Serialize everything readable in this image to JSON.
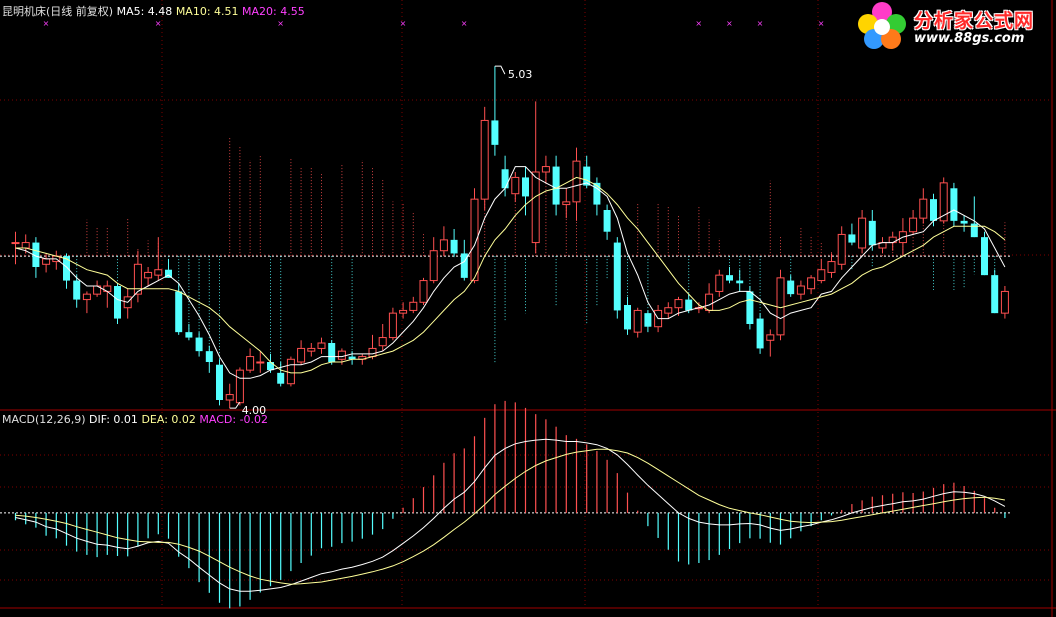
{
  "header": {
    "title": "昆明机床(日线 前复权)",
    "ma5": "MA5: 4.48",
    "ma10": "MA10: 4.51",
    "ma20": "MA20: 4.55",
    "macd_label": "MACD(12,26,9)",
    "dif": "DIF: 0.01",
    "dea": "DEA: 0.02",
    "macd": "MACD: -0.02"
  },
  "logo": {
    "text": "分析家公式网",
    "url": "www.88gs.com",
    "icon": "flower-icon"
  },
  "colors": {
    "up": "#ff5050",
    "down": "#54ffff",
    "ma5": "#ffffff",
    "ma10": "#ffff99",
    "grid": "#800000",
    "macd_text": "#ff40ff"
  },
  "chart_data": [
    {
      "type": "candlestick",
      "title": "昆明机床(日线 前复权)",
      "annotations": [
        {
          "label": "5.03",
          "kind": "high"
        },
        {
          "label": "4.00",
          "kind": "low"
        }
      ],
      "ylim": [
        3.8,
        5.2
      ],
      "candles": [
        {
          "o": 4.38,
          "h": 4.42,
          "l": 4.3,
          "c": 4.38
        },
        {
          "o": 4.36,
          "h": 4.41,
          "l": 4.34,
          "c": 4.38
        },
        {
          "o": 4.38,
          "h": 4.4,
          "l": 4.25,
          "c": 4.29
        },
        {
          "o": 4.3,
          "h": 4.34,
          "l": 4.27,
          "c": 4.32
        },
        {
          "o": 4.31,
          "h": 4.35,
          "l": 4.28,
          "c": 4.33
        },
        {
          "o": 4.33,
          "h": 4.34,
          "l": 4.21,
          "c": 4.24
        },
        {
          "o": 4.24,
          "h": 4.26,
          "l": 4.14,
          "c": 4.17
        },
        {
          "o": 4.17,
          "h": 4.2,
          "l": 4.12,
          "c": 4.19
        },
        {
          "o": 4.19,
          "h": 4.24,
          "l": 4.18,
          "c": 4.22
        },
        {
          "o": 4.2,
          "h": 4.24,
          "l": 4.14,
          "c": 4.22
        },
        {
          "o": 4.22,
          "h": 4.23,
          "l": 4.08,
          "c": 4.1
        },
        {
          "o": 4.14,
          "h": 4.21,
          "l": 4.1,
          "c": 4.18
        },
        {
          "o": 4.19,
          "h": 4.35,
          "l": 4.16,
          "c": 4.3
        },
        {
          "o": 4.25,
          "h": 4.29,
          "l": 4.22,
          "c": 4.27
        },
        {
          "o": 4.26,
          "h": 4.4,
          "l": 4.24,
          "c": 4.28
        },
        {
          "o": 4.28,
          "h": 4.32,
          "l": 4.25,
          "c": 4.25
        },
        {
          "o": 4.2,
          "h": 4.23,
          "l": 4.04,
          "c": 4.05
        },
        {
          "o": 4.05,
          "h": 4.08,
          "l": 4.02,
          "c": 4.03
        },
        {
          "o": 4.03,
          "h": 4.05,
          "l": 3.96,
          "c": 3.98
        },
        {
          "o": 3.98,
          "h": 4.0,
          "l": 3.9,
          "c": 3.94
        },
        {
          "o": 3.93,
          "h": 3.95,
          "l": 3.78,
          "c": 3.8
        },
        {
          "o": 3.8,
          "h": 3.86,
          "l": 3.77,
          "c": 3.82
        },
        {
          "o": 3.79,
          "h": 3.92,
          "l": 3.78,
          "c": 3.91
        },
        {
          "o": 3.91,
          "h": 3.99,
          "l": 3.9,
          "c": 3.96
        },
        {
          "o": 3.94,
          "h": 3.98,
          "l": 3.9,
          "c": 3.94
        },
        {
          "o": 3.94,
          "h": 3.97,
          "l": 3.9,
          "c": 3.91
        },
        {
          "o": 3.9,
          "h": 3.94,
          "l": 3.85,
          "c": 3.86
        },
        {
          "o": 3.86,
          "h": 3.96,
          "l": 3.85,
          "c": 3.95
        },
        {
          "o": 3.94,
          "h": 4.02,
          "l": 3.93,
          "c": 3.99
        },
        {
          "o": 3.98,
          "h": 4.01,
          "l": 3.96,
          "c": 3.99
        },
        {
          "o": 3.99,
          "h": 4.03,
          "l": 3.97,
          "c": 4.01
        },
        {
          "o": 4.01,
          "h": 4.02,
          "l": 3.93,
          "c": 3.94
        },
        {
          "o": 3.95,
          "h": 3.99,
          "l": 3.93,
          "c": 3.98
        },
        {
          "o": 3.96,
          "h": 3.98,
          "l": 3.93,
          "c": 3.95
        },
        {
          "o": 3.95,
          "h": 3.97,
          "l": 3.93,
          "c": 3.96
        },
        {
          "o": 3.96,
          "h": 4.04,
          "l": 3.95,
          "c": 3.99
        },
        {
          "o": 4.0,
          "h": 4.08,
          "l": 3.98,
          "c": 4.03
        },
        {
          "o": 4.03,
          "h": 4.14,
          "l": 4.02,
          "c": 4.12
        },
        {
          "o": 4.12,
          "h": 4.16,
          "l": 4.1,
          "c": 4.13
        },
        {
          "o": 4.13,
          "h": 4.18,
          "l": 4.12,
          "c": 4.16
        },
        {
          "o": 4.16,
          "h": 4.25,
          "l": 4.15,
          "c": 4.24
        },
        {
          "o": 4.24,
          "h": 4.4,
          "l": 4.23,
          "c": 4.35
        },
        {
          "o": 4.35,
          "h": 4.44,
          "l": 4.33,
          "c": 4.39
        },
        {
          "o": 4.39,
          "h": 4.43,
          "l": 4.33,
          "c": 4.34
        },
        {
          "o": 4.34,
          "h": 4.39,
          "l": 4.24,
          "c": 4.25
        },
        {
          "o": 4.24,
          "h": 4.58,
          "l": 4.23,
          "c": 4.54
        },
        {
          "o": 4.54,
          "h": 4.88,
          "l": 4.5,
          "c": 4.83
        },
        {
          "o": 4.83,
          "h": 5.03,
          "l": 4.7,
          "c": 4.74
        },
        {
          "o": 4.65,
          "h": 4.7,
          "l": 4.55,
          "c": 4.58
        },
        {
          "o": 4.56,
          "h": 4.64,
          "l": 4.53,
          "c": 4.62
        },
        {
          "o": 4.62,
          "h": 4.66,
          "l": 4.48,
          "c": 4.55
        },
        {
          "o": 4.38,
          "h": 4.9,
          "l": 4.34,
          "c": 4.64
        },
        {
          "o": 4.64,
          "h": 4.7,
          "l": 4.6,
          "c": 4.66
        },
        {
          "o": 4.66,
          "h": 4.7,
          "l": 4.48,
          "c": 4.52
        },
        {
          "o": 4.52,
          "h": 4.58,
          "l": 4.47,
          "c": 4.53
        },
        {
          "o": 4.53,
          "h": 4.73,
          "l": 4.46,
          "c": 4.68
        },
        {
          "o": 4.66,
          "h": 4.7,
          "l": 4.58,
          "c": 4.59
        },
        {
          "o": 4.6,
          "h": 4.62,
          "l": 4.48,
          "c": 4.52
        },
        {
          "o": 4.5,
          "h": 4.52,
          "l": 4.39,
          "c": 4.42
        },
        {
          "o": 4.38,
          "h": 4.4,
          "l": 4.1,
          "c": 4.13
        },
        {
          "o": 4.15,
          "h": 4.18,
          "l": 4.04,
          "c": 4.06
        },
        {
          "o": 4.05,
          "h": 4.14,
          "l": 4.03,
          "c": 4.13
        },
        {
          "o": 4.12,
          "h": 4.13,
          "l": 4.05,
          "c": 4.07
        },
        {
          "o": 4.07,
          "h": 4.15,
          "l": 4.05,
          "c": 4.13
        },
        {
          "o": 4.12,
          "h": 4.16,
          "l": 4.1,
          "c": 4.14
        },
        {
          "o": 4.14,
          "h": 4.18,
          "l": 4.11,
          "c": 4.17
        },
        {
          "o": 4.17,
          "h": 4.19,
          "l": 4.12,
          "c": 4.13
        },
        {
          "o": 4.14,
          "h": 4.16,
          "l": 4.12,
          "c": 4.14
        },
        {
          "o": 4.13,
          "h": 4.23,
          "l": 4.12,
          "c": 4.19
        },
        {
          "o": 4.2,
          "h": 4.28,
          "l": 4.18,
          "c": 4.26
        },
        {
          "o": 4.26,
          "h": 4.29,
          "l": 4.23,
          "c": 4.24
        },
        {
          "o": 4.24,
          "h": 4.28,
          "l": 4.2,
          "c": 4.23
        },
        {
          "o": 4.2,
          "h": 4.22,
          "l": 4.06,
          "c": 4.08
        },
        {
          "o": 4.1,
          "h": 4.12,
          "l": 3.97,
          "c": 3.99
        },
        {
          "o": 4.02,
          "h": 4.06,
          "l": 3.96,
          "c": 4.04
        },
        {
          "o": 4.04,
          "h": 4.28,
          "l": 4.02,
          "c": 4.25
        },
        {
          "o": 4.24,
          "h": 4.26,
          "l": 4.18,
          "c": 4.19
        },
        {
          "o": 4.19,
          "h": 4.24,
          "l": 4.17,
          "c": 4.22
        },
        {
          "o": 4.21,
          "h": 4.26,
          "l": 4.19,
          "c": 4.25
        },
        {
          "o": 4.24,
          "h": 4.32,
          "l": 4.23,
          "c": 4.28
        },
        {
          "o": 4.27,
          "h": 4.34,
          "l": 4.25,
          "c": 4.31
        },
        {
          "o": 4.3,
          "h": 4.44,
          "l": 4.28,
          "c": 4.41
        },
        {
          "o": 4.41,
          "h": 4.45,
          "l": 4.37,
          "c": 4.38
        },
        {
          "o": 4.36,
          "h": 4.5,
          "l": 4.34,
          "c": 4.47
        },
        {
          "o": 4.46,
          "h": 4.5,
          "l": 4.35,
          "c": 4.37
        },
        {
          "o": 4.36,
          "h": 4.4,
          "l": 4.34,
          "c": 4.38
        },
        {
          "o": 4.38,
          "h": 4.42,
          "l": 4.35,
          "c": 4.4
        },
        {
          "o": 4.38,
          "h": 4.47,
          "l": 4.33,
          "c": 4.42
        },
        {
          "o": 4.42,
          "h": 4.5,
          "l": 4.41,
          "c": 4.47
        },
        {
          "o": 4.47,
          "h": 4.58,
          "l": 4.45,
          "c": 4.54
        },
        {
          "o": 4.54,
          "h": 4.56,
          "l": 4.44,
          "c": 4.46
        },
        {
          "o": 4.46,
          "h": 4.62,
          "l": 4.45,
          "c": 4.6
        },
        {
          "o": 4.58,
          "h": 4.6,
          "l": 4.44,
          "c": 4.46
        },
        {
          "o": 4.46,
          "h": 4.48,
          "l": 4.42,
          "c": 4.45
        },
        {
          "o": 4.45,
          "h": 4.55,
          "l": 4.4,
          "c": 4.4
        },
        {
          "o": 4.4,
          "h": 4.42,
          "l": 4.26,
          "c": 4.26
        },
        {
          "o": 4.26,
          "h": 4.28,
          "l": 4.12,
          "c": 4.12
        },
        {
          "o": 4.12,
          "h": 4.22,
          "l": 4.1,
          "c": 4.2
        }
      ],
      "ma5": [
        4.36,
        4.35,
        4.33,
        4.32,
        4.32,
        4.29,
        4.25,
        4.22,
        4.22,
        4.2,
        4.17,
        4.16,
        4.2,
        4.22,
        4.24,
        4.26,
        4.23,
        4.17,
        4.11,
        4.04,
        3.96,
        3.9,
        3.88,
        3.88,
        3.89,
        3.91,
        3.92,
        3.93,
        3.93,
        3.94,
        3.96,
        3.96,
        3.96,
        3.97,
        3.97,
        3.97,
        3.98,
        4.01,
        4.05,
        4.09,
        4.14,
        4.2,
        4.25,
        4.29,
        4.31,
        4.37,
        4.47,
        4.54,
        4.58,
        4.66,
        4.66,
        4.62,
        4.6,
        4.58,
        4.58,
        4.59,
        4.6,
        4.58,
        4.55,
        4.47,
        4.34,
        4.26,
        4.16,
        4.1,
        4.1,
        4.12,
        4.13,
        4.14,
        4.15,
        4.17,
        4.19,
        4.2,
        4.2,
        4.17,
        4.12,
        4.1,
        4.12,
        4.13,
        4.14,
        4.19,
        4.2,
        4.25,
        4.29,
        4.33,
        4.37,
        4.38,
        4.38,
        4.4,
        4.41,
        4.42,
        4.46,
        4.48,
        4.5,
        4.48,
        4.46,
        4.43,
        4.36,
        4.29
      ],
      "ma10": [
        4.36,
        4.36,
        4.35,
        4.34,
        4.33,
        4.32,
        4.3,
        4.28,
        4.27,
        4.26,
        4.23,
        4.21,
        4.21,
        4.21,
        4.21,
        4.21,
        4.2,
        4.18,
        4.16,
        4.14,
        4.11,
        4.07,
        4.04,
        4.01,
        3.98,
        3.94,
        3.91,
        3.9,
        3.9,
        3.91,
        3.93,
        3.94,
        3.94,
        3.95,
        3.95,
        3.96,
        3.97,
        3.98,
        4.0,
        4.02,
        4.05,
        4.09,
        4.13,
        4.17,
        4.2,
        4.25,
        4.33,
        4.39,
        4.43,
        4.48,
        4.52,
        4.55,
        4.57,
        4.58,
        4.6,
        4.62,
        4.61,
        4.59,
        4.56,
        4.52,
        4.47,
        4.43,
        4.38,
        4.33,
        4.28,
        4.23,
        4.19,
        4.15,
        4.13,
        4.13,
        4.14,
        4.16,
        4.17,
        4.16,
        4.15,
        4.14,
        4.15,
        4.16,
        4.17,
        4.18,
        4.19,
        4.21,
        4.23,
        4.26,
        4.28,
        4.29,
        4.31,
        4.33,
        4.35,
        4.37,
        4.4,
        4.42,
        4.44,
        4.44,
        4.44,
        4.44,
        4.42,
        4.39
      ]
    },
    {
      "type": "bar",
      "title": "MACD(12,26,9)",
      "series_labels": [
        "DIF: 0.01",
        "DEA: 0.02",
        "MACD: -0.02"
      ],
      "ylim": [
        -0.2,
        0.18
      ],
      "dif": [
        -0.01,
        -0.015,
        -0.02,
        -0.03,
        -0.035,
        -0.045,
        -0.055,
        -0.062,
        -0.068,
        -0.07,
        -0.075,
        -0.078,
        -0.072,
        -0.065,
        -0.062,
        -0.066,
        -0.085,
        -0.1,
        -0.118,
        -0.135,
        -0.152,
        -0.165,
        -0.17,
        -0.17,
        -0.168,
        -0.165,
        -0.162,
        -0.156,
        -0.148,
        -0.14,
        -0.132,
        -0.128,
        -0.122,
        -0.118,
        -0.112,
        -0.105,
        -0.096,
        -0.082,
        -0.066,
        -0.05,
        -0.032,
        -0.012,
        0.01,
        0.03,
        0.045,
        0.068,
        0.098,
        0.125,
        0.14,
        0.15,
        0.155,
        0.158,
        0.16,
        0.158,
        0.155,
        0.155,
        0.152,
        0.148,
        0.14,
        0.126,
        0.105,
        0.082,
        0.06,
        0.04,
        0.02,
        0.0,
        -0.012,
        -0.02,
        -0.024,
        -0.026,
        -0.026,
        -0.024,
        -0.023,
        -0.026,
        -0.033,
        -0.038,
        -0.035,
        -0.03,
        -0.026,
        -0.02,
        -0.015,
        -0.008,
        0.0,
        0.006,
        0.012,
        0.016,
        0.02,
        0.024,
        0.026,
        0.03,
        0.036,
        0.042,
        0.046,
        0.045,
        0.042,
        0.036,
        0.026,
        0.014
      ],
      "dea": [
        -0.005,
        -0.007,
        -0.01,
        -0.014,
        -0.018,
        -0.023,
        -0.03,
        -0.036,
        -0.042,
        -0.048,
        -0.054,
        -0.058,
        -0.062,
        -0.063,
        -0.064,
        -0.064,
        -0.068,
        -0.075,
        -0.083,
        -0.094,
        -0.106,
        -0.118,
        -0.128,
        -0.137,
        -0.144,
        -0.148,
        -0.152,
        -0.155,
        -0.154,
        -0.152,
        -0.15,
        -0.146,
        -0.142,
        -0.138,
        -0.133,
        -0.128,
        -0.122,
        -0.115,
        -0.106,
        -0.095,
        -0.083,
        -0.069,
        -0.053,
        -0.036,
        -0.02,
        -0.002,
        0.018,
        0.04,
        0.058,
        0.075,
        0.09,
        0.103,
        0.113,
        0.12,
        0.127,
        0.132,
        0.135,
        0.138,
        0.138,
        0.135,
        0.13,
        0.12,
        0.108,
        0.094,
        0.08,
        0.066,
        0.052,
        0.038,
        0.028,
        0.018,
        0.01,
        0.005,
        0.0,
        -0.004,
        -0.009,
        -0.014,
        -0.018,
        -0.02,
        -0.021,
        -0.02,
        -0.019,
        -0.016,
        -0.012,
        -0.008,
        -0.004,
        0.0,
        0.004,
        0.008,
        0.012,
        0.016,
        0.02,
        0.024,
        0.028,
        0.031,
        0.033,
        0.034,
        0.032,
        0.028
      ]
    }
  ]
}
